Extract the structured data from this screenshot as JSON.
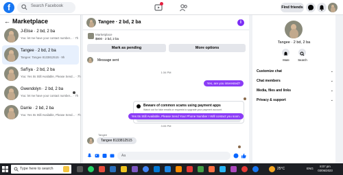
{
  "topnav": {
    "search_placeholder": "Search Facebook",
    "find_friends_label": "Find friends"
  },
  "left": {
    "title": "Marketplace",
    "conversations": [
      {
        "name": "J-Elise · 2 bd, 2 ba",
        "preview": "You: let me have your contact number... · 7h"
      },
      {
        "name": "Tangee · 2 bd, 2 ba",
        "preview": "Tangee: Tangee 8133812515 · 9h"
      },
      {
        "name": "Saf'iya · 2 bd, 2 ba",
        "preview": "You: Yes Its Still Available, Please Send... · 7h"
      },
      {
        "name": "Gwendolyn · 2 bd, 2 ba",
        "preview": "You: let me have your contact number... · 7h"
      },
      {
        "name": "Darrie · 2 bd, 2 ba",
        "preview": "You: Yes Its Still Available, Please Send... · 7h"
      }
    ]
  },
  "chat": {
    "title": "Tangee · 2 bd, 2 ba",
    "listing_label": "Marketplace",
    "listing_price": "$900 · 2 bd, 2 ba",
    "mark_pending_label": "Mark as pending",
    "more_options_label": "More options",
    "system_message": "Message sent",
    "time_1": "1:34 PM",
    "out_message_1": "Yes, are you interested?",
    "scam_title": "Beware of common scams using payment apps",
    "scam_desc": "Watch out for fake emails or requests to upgrade your payment account.",
    "learn_more_label": "Learn More",
    "out_message_2": "Yes Its Still Available, Please Send Your Phone Number I Will contact you soon.",
    "time_2": "3:05 PM",
    "sender_name": "Tangee",
    "in_message": "Tangee 8133812515",
    "composer_placeholder": "Aa"
  },
  "right": {
    "name": "Tangee · 2 bd, 2 ba",
    "mute_label": "Mute",
    "search_label": "Search",
    "sections": [
      "Customize chat",
      "Chat members",
      "Media, files and links",
      "Privacy & support"
    ]
  },
  "taskbar": {
    "search_placeholder": "Type here to search",
    "weather": "25°C",
    "language": "ENG",
    "time": "8:07 pm",
    "date": "03/06/2023"
  },
  "colors": {
    "brand_blue": "#1877f2",
    "message_purple": "#8b3cf6",
    "notification_red": "#e41e3f"
  }
}
